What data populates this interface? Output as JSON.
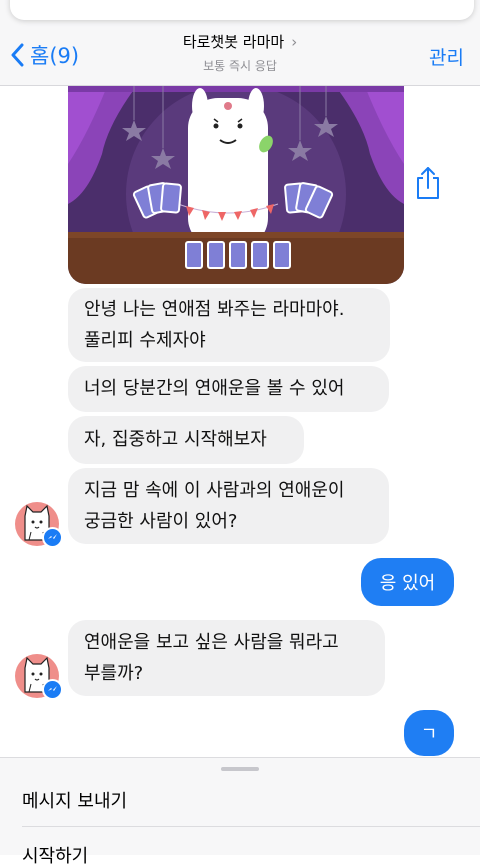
{
  "header": {
    "back_label": "홈(9)",
    "title": "타로챗봇 라마마",
    "subtitle": "보통 즉시 응답",
    "manage_label": "관리"
  },
  "messages": {
    "bot1_line1": "안녕 나는 연애점 봐주는 라마마야.",
    "bot1_line2": "풀리피 수제자야",
    "bot2": "너의 당분간의 연애운을 볼 수 있어",
    "bot3": "자, 집중하고 시작해보자",
    "bot4_line1": "지금 맘 속에 이 사람과의 연애운이",
    "bot4_line2": "궁금한 사람이 있어?",
    "user1": "응 있어",
    "bot5_line1": "연애운을 보고 싶은 사람을 뭐라고",
    "bot5_line2": "부를까?",
    "user2": "ㄱ"
  },
  "composer": {
    "item1": "메시지 보내기",
    "item2": "시작하기"
  },
  "colors": {
    "accent": "#1a7cf5",
    "user_bubble": "#1f7ef3",
    "bot_bubble": "#f0f0f1",
    "banner_purple": "#4b2e6b",
    "curtain": "#8b44b8"
  },
  "icons": {
    "back": "chevron-left-icon",
    "share": "share-icon",
    "avatar": "cat-avatar-icon",
    "messenger_badge": "messenger-icon"
  }
}
